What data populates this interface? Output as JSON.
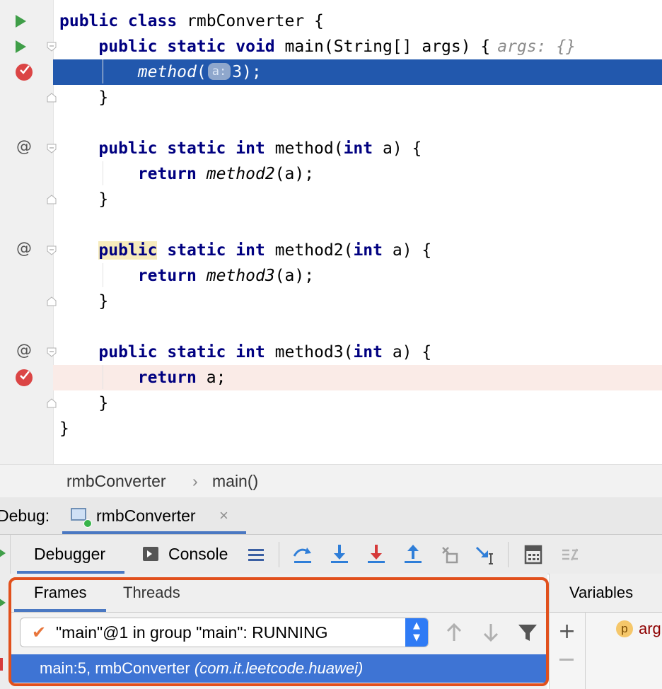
{
  "editor": {
    "lines": [
      {
        "tokens": [
          {
            "t": "public class",
            "c": "kw"
          },
          {
            "t": " rmbConverter {",
            "c": ""
          }
        ]
      },
      {
        "tokens": [
          {
            "t": "    "
          },
          {
            "t": "public static void",
            "c": "kw"
          },
          {
            "t": " main(String[] args) {"
          },
          {
            "t": "args: {}",
            "c": "hint"
          }
        ]
      },
      {
        "tokens": [
          {
            "t": "        "
          },
          {
            "t": "method",
            "c": "it"
          },
          {
            "t": "("
          },
          {
            "t": "a:",
            "c": "param"
          },
          {
            "t": "3);"
          }
        ]
      },
      {
        "tokens": [
          {
            "t": "    }"
          }
        ]
      },
      {
        "tokens": []
      },
      {
        "tokens": [
          {
            "t": "    "
          },
          {
            "t": "public static int",
            "c": "kw"
          },
          {
            "t": " method("
          },
          {
            "t": "int",
            "c": "kw"
          },
          {
            "t": " a) {"
          }
        ]
      },
      {
        "tokens": [
          {
            "t": "        "
          },
          {
            "t": "return",
            "c": "kw"
          },
          {
            "t": " "
          },
          {
            "t": "method2",
            "c": "it"
          },
          {
            "t": "(a);"
          }
        ]
      },
      {
        "tokens": [
          {
            "t": "    }"
          }
        ]
      },
      {
        "tokens": []
      },
      {
        "tokens": [
          {
            "t": "    "
          },
          {
            "t": "public",
            "c": "kw kw-hl"
          },
          {
            "t": " "
          },
          {
            "t": "static int",
            "c": "kw"
          },
          {
            "t": " method2("
          },
          {
            "t": "int",
            "c": "kw"
          },
          {
            "t": " a) {"
          }
        ]
      },
      {
        "tokens": [
          {
            "t": "        "
          },
          {
            "t": "return",
            "c": "kw"
          },
          {
            "t": " "
          },
          {
            "t": "method3",
            "c": "it"
          },
          {
            "t": "(a);"
          }
        ]
      },
      {
        "tokens": [
          {
            "t": "    }"
          }
        ]
      },
      {
        "tokens": []
      },
      {
        "tokens": [
          {
            "t": "    "
          },
          {
            "t": "public static int",
            "c": "kw"
          },
          {
            "t": " method3("
          },
          {
            "t": "int",
            "c": "kw"
          },
          {
            "t": " a) {"
          }
        ]
      },
      {
        "tokens": [
          {
            "t": "        "
          },
          {
            "t": "return",
            "c": "kw"
          },
          {
            "t": " a;"
          }
        ]
      },
      {
        "tokens": [
          {
            "t": "    }"
          }
        ]
      },
      {
        "tokens": [
          {
            "t": "}"
          }
        ]
      }
    ],
    "gutter_icons": [
      "run-icon",
      "run-icon",
      "breakpoint-icon",
      "",
      "",
      "override-at-icon",
      "",
      "",
      "",
      "override-at-icon",
      "",
      "",
      "",
      "override-at-icon",
      "breakpoint-icon",
      "",
      ""
    ],
    "current_line_index": 2,
    "breakpoint_line_index": 14
  },
  "breadcrumb": {
    "class_name": "rmbConverter",
    "separator": "›",
    "method_name": "main()"
  },
  "debug_bar": {
    "label": "Debug:",
    "tab_label": "rmbConverter",
    "close_glyph": "×"
  },
  "toolbar": {
    "debugger_tab": "Debugger",
    "console_tab": "Console",
    "buttons": [
      "show-execution-point",
      "step-over",
      "step-into",
      "force-step-into",
      "step-out",
      "drop-frame",
      "run-to-cursor",
      "evaluate-expression",
      "trace"
    ]
  },
  "frames": {
    "tab_frames": "Frames",
    "tab_threads": "Threads",
    "thread_value": "\"main\"@1 in group \"main\": RUNNING",
    "selected_frame": "main:5, rmbConverter",
    "selected_frame_package": "(com.it.leetcode.huawei)"
  },
  "variables": {
    "header": "Variables",
    "first_item_badge": "p",
    "first_item_name": "arg"
  },
  "colors": {
    "current_line": "#2258ad",
    "breakpoint_line": "#faebe7",
    "keyword": "#000080",
    "selection": "#3e74d4",
    "highlight_box": "#e1501c",
    "accent": "#4a78c2"
  }
}
